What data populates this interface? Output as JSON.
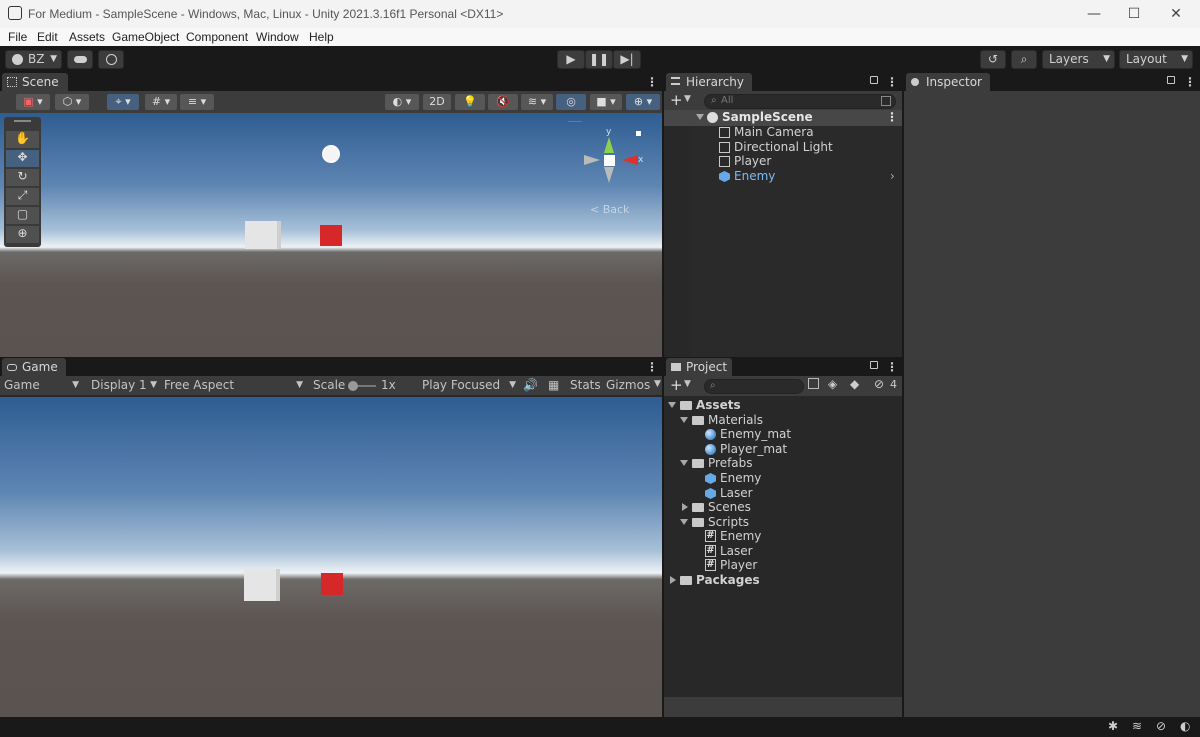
{
  "window": {
    "title": "For Medium - SampleScene - Windows, Mac, Linux - Unity 2021.3.16f1 Personal <DX11>"
  },
  "menu": [
    "File",
    "Edit",
    "Assets",
    "GameObject",
    "Component",
    "Window",
    "Help"
  ],
  "toolbar": {
    "account": "BZ",
    "layers": "Layers",
    "layout": "Layout"
  },
  "scene": {
    "tab": "Scene",
    "mode_2d": "2D",
    "gizmo_back": "< Back",
    "axis_y": "y",
    "axis_x": "x"
  },
  "game": {
    "tab": "Game",
    "view": "Game",
    "display": "Display 1",
    "aspect": "Free Aspect",
    "scale_label": "Scale",
    "scale_value": "1x",
    "play_mode": "Play Focused",
    "stats": "Stats",
    "gizmos": "Gizmos"
  },
  "hierarchy": {
    "tab": "Hierarchy",
    "search_placeholder": "All",
    "scene": "SampleScene",
    "items": [
      "Main Camera",
      "Directional Light",
      "Player",
      "Enemy"
    ]
  },
  "inspector": {
    "tab": "Inspector"
  },
  "project": {
    "tab": "Project",
    "hidden_count": "4",
    "tree": {
      "assets": "Assets",
      "materials": "Materials",
      "enemy_mat": "Enemy_mat",
      "player_mat": "Player_mat",
      "prefabs": "Prefabs",
      "enemy_prefab": "Enemy",
      "laser_prefab": "Laser",
      "scenes": "Scenes",
      "scripts": "Scripts",
      "enemy_script": "Enemy",
      "laser_script": "Laser",
      "player_script": "Player",
      "packages": "Packages"
    }
  },
  "colors": {
    "accent": "#4c7bd9",
    "enemy_link": "#6fb3ff",
    "red_cube": "#d62828"
  }
}
